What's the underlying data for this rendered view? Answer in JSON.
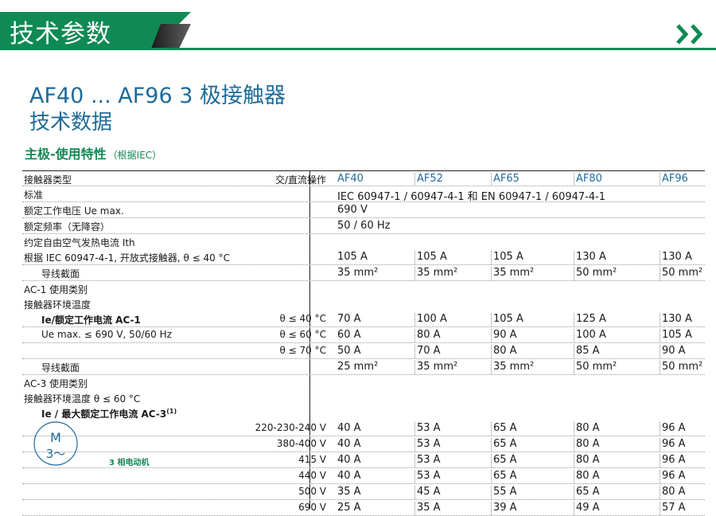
{
  "banner": {
    "title": "技术参数"
  },
  "heading": {
    "line1": "AF40 ... AF96  3 极接触器",
    "line2": "技术数据"
  },
  "section": {
    "title": "主极-使用特性",
    "note": "（根据IEC）"
  },
  "table": {
    "header": {
      "label": "接触器类型",
      "op": "交/直流操作",
      "models": [
        "AF40",
        "AF52",
        "AF65",
        "AF80",
        "AF96"
      ]
    },
    "standard": {
      "label": "标准",
      "value": "IEC 60947-1 / 60947-4-1 和 EN 60947-1 / 60947-4-1"
    },
    "voltage": {
      "label": "额定工作电压 Ue max.",
      "value": "690 V"
    },
    "frequency": {
      "label": "额定频率（无降容）",
      "value": "50 / 60 Hz"
    },
    "ith": {
      "label": "约定自由空气发热电流 Ith",
      "cond": "根据 IEC 60947-4-1, 开放式接触器, θ ≤ 40 °C",
      "values": [
        "105 A",
        "105 A",
        "105 A",
        "130 A",
        "130 A"
      ],
      "cs_label": "导线截面",
      "cs_values": [
        "35 mm²",
        "35 mm²",
        "35 mm²",
        "50 mm²",
        "50 mm²"
      ]
    },
    "ac1": {
      "title": "AC-1 使用类别",
      "env": "接触器环境温度",
      "ie_label": "Ie/额定工作电流 AC-1",
      "ue_note": "Ue max. ≤ 690 V, 50/60 Hz",
      "rows": [
        {
          "t": "θ ≤ 40 °C",
          "values": [
            "70 A",
            "100 A",
            "105 A",
            "125 A",
            "130 A"
          ]
        },
        {
          "t": "θ ≤ 60 °C",
          "values": [
            "60 A",
            "80 A",
            "90 A",
            "100 A",
            "105 A"
          ]
        },
        {
          "t": "θ ≤ 70 °C",
          "values": [
            "50 A",
            "70 A",
            "80 A",
            "85 A",
            "90 A"
          ]
        }
      ],
      "cs_label": "导线截面",
      "cs_values": [
        "25 mm²",
        "35 mm²",
        "35 mm²",
        "50 mm²",
        "50 mm²"
      ]
    },
    "ac3": {
      "title": "AC-3 使用类别",
      "env": "接触器环境温度 θ ≤ 60 °C",
      "ie_label": "Ie / 最大额定工作电流 AC-3",
      "ie_sup": "(1)",
      "rows": [
        {
          "v": "220-230-240 V",
          "values": [
            "40 A",
            "53 A",
            "65 A",
            "80 A",
            "96 A"
          ]
        },
        {
          "v": "380-400 V",
          "values": [
            "40 A",
            "53 A",
            "65 A",
            "80 A",
            "96 A"
          ]
        },
        {
          "v": "415 V",
          "values": [
            "40 A",
            "53 A",
            "65 A",
            "80 A",
            "96 A"
          ]
        },
        {
          "v": "440 V",
          "values": [
            "40 A",
            "53 A",
            "65 A",
            "80 A",
            "96 A"
          ]
        },
        {
          "v": "500 V",
          "values": [
            "35 A",
            "45 A",
            "55 A",
            "65 A",
            "80 A"
          ]
        },
        {
          "v": "690 V",
          "values": [
            "25 A",
            "35 A",
            "39 A",
            "49 A",
            "57 A"
          ]
        }
      ]
    }
  },
  "motor": {
    "letter": "M",
    "phase": "3～",
    "label": "3 相电动机"
  },
  "colors": {
    "brand_green": "#0f8a55",
    "heading_blue": "#1e6b9a"
  }
}
